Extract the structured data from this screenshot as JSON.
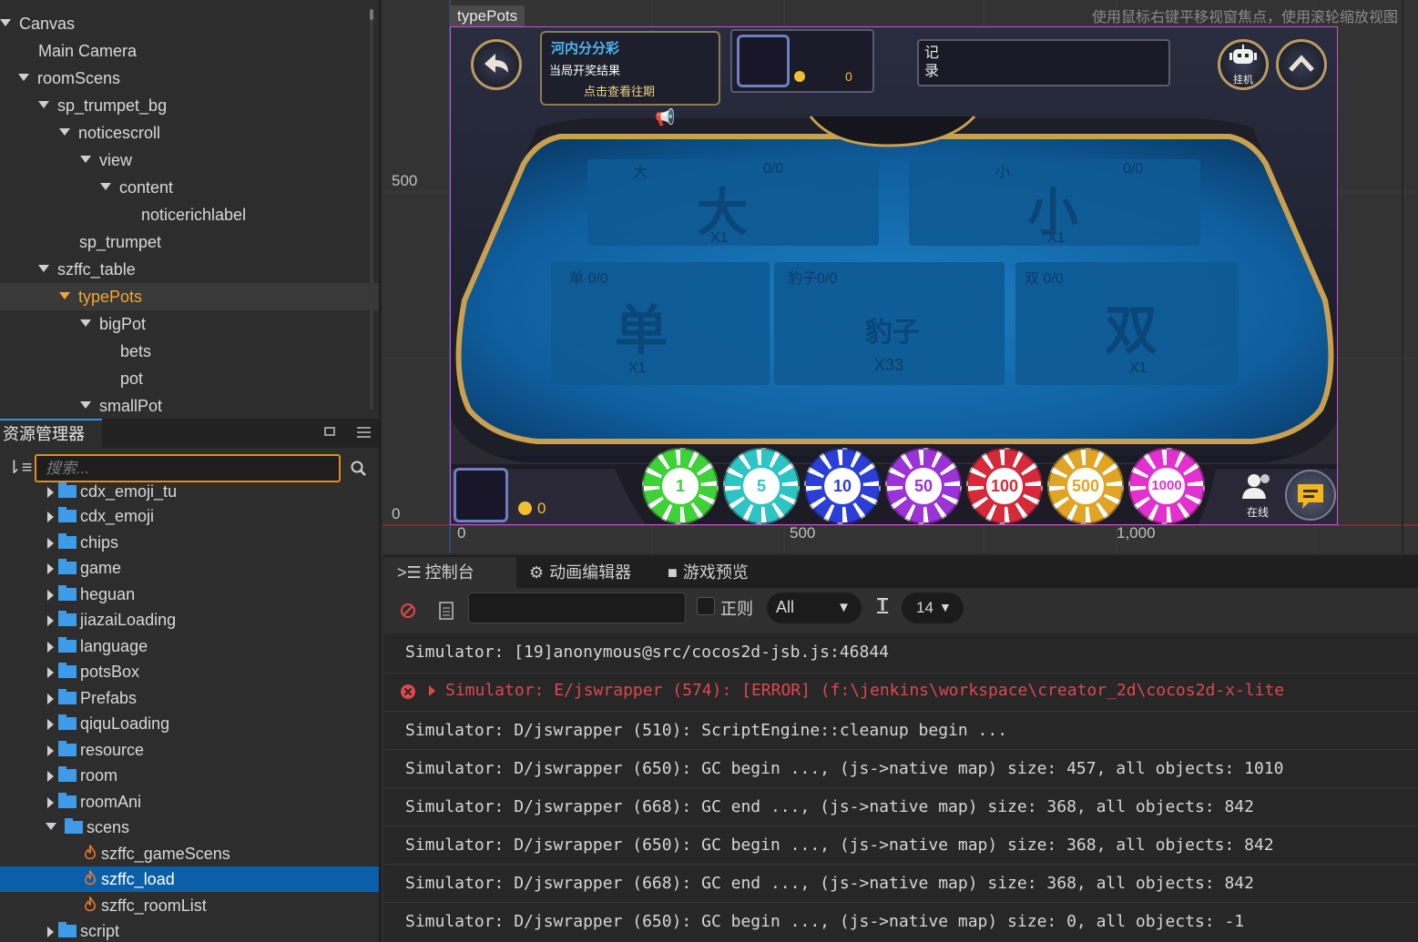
{
  "hierarchy": {
    "rows": [
      {
        "label": "Canvas",
        "expanded": true
      },
      {
        "label": "Main Camera",
        "expanded": false
      },
      {
        "label": "roomScens",
        "expanded": true
      },
      {
        "label": "sp_trumpet_bg",
        "expanded": true
      },
      {
        "label": "noticescroll",
        "expanded": true
      },
      {
        "label": "view",
        "expanded": true
      },
      {
        "label": "content",
        "expanded": true
      },
      {
        "label": "noticerichlabel",
        "expanded": false
      },
      {
        "label": "sp_trumpet",
        "expanded": false
      },
      {
        "label": "szffc_table",
        "expanded": true
      },
      {
        "label": "typePots",
        "expanded": true,
        "selected": true
      },
      {
        "label": "bigPot",
        "expanded": true
      },
      {
        "label": "bets",
        "expanded": false
      },
      {
        "label": "pot",
        "expanded": false
      },
      {
        "label": "smallPot",
        "expanded": true
      }
    ]
  },
  "assets": {
    "tab_label": "资源管理器",
    "search_placeholder": "搜索...",
    "rows": [
      {
        "label": "cdx_emoji_tu",
        "type": "folder"
      },
      {
        "label": "cdx_emoji",
        "type": "folder"
      },
      {
        "label": "chips",
        "type": "folder"
      },
      {
        "label": "game",
        "type": "folder"
      },
      {
        "label": "heguan",
        "type": "folder"
      },
      {
        "label": "jiazaiLoading",
        "type": "folder"
      },
      {
        "label": "language",
        "type": "folder"
      },
      {
        "label": "potsBox",
        "type": "folder"
      },
      {
        "label": "Prefabs",
        "type": "folder"
      },
      {
        "label": "qiquLoading",
        "type": "folder"
      },
      {
        "label": "resource",
        "type": "folder"
      },
      {
        "label": "room",
        "type": "folder"
      },
      {
        "label": "roomAni",
        "type": "folder"
      },
      {
        "label": "scens",
        "type": "folder",
        "expanded": true
      },
      {
        "label": "szffc_gameScens",
        "type": "scene"
      },
      {
        "label": "szffc_load",
        "type": "scene",
        "selected": true
      },
      {
        "label": "szffc_roomList",
        "type": "scene"
      },
      {
        "label": "script",
        "type": "folder"
      }
    ]
  },
  "scene": {
    "hint": "使用鼠标右键平移视窗焦点，使用滚轮缩放视图",
    "node_label": "typePots",
    "y_ticks": [
      "500",
      "0"
    ],
    "x_ticks": [
      "0",
      "500",
      "1,000"
    ]
  },
  "game": {
    "lottery_title": "河内分分彩",
    "lottery_sub": "当局开奖结果",
    "lottery_link": "点击查看往期",
    "top_coins": "0",
    "record_label_1": "记",
    "record_label_2": "录",
    "robot_label": "挂机",
    "pots": [
      {
        "char": "大",
        "label": "大",
        "ratio": "0/0",
        "mult": "X1"
      },
      {
        "char": "小",
        "label": "小",
        "ratio": "0/0",
        "mult": "X1"
      },
      {
        "char": "单",
        "label": "单 0/0",
        "mult": "X1"
      },
      {
        "char": "豹子",
        "label": "豹子0/0",
        "mult": "X33"
      },
      {
        "char": "双",
        "label": "双 0/0",
        "mult": "X1"
      }
    ],
    "bottom_coins": "0",
    "chips": [
      {
        "value": "1",
        "color": "#3fd13a"
      },
      {
        "value": "5",
        "color": "#2fc4c4"
      },
      {
        "value": "10",
        "color": "#2b3fd6"
      },
      {
        "value": "50",
        "color": "#9b33d6"
      },
      {
        "value": "100",
        "color": "#d42a3a"
      },
      {
        "value": "500",
        "color": "#e0a426"
      },
      {
        "value": "1000",
        "color": "#e231cf"
      }
    ],
    "online_label": "在线"
  },
  "console": {
    "tabs": [
      "控制台",
      "动画编辑器",
      "游戏预览"
    ],
    "regex_label": "正则",
    "level_select": "All",
    "font_size": "14",
    "lines": [
      {
        "text": "Simulator: [19]anonymous@src/cocos2d-jsb.js:46844",
        "error": false
      },
      {
        "text": "Simulator: E/jswrapper (574): [ERROR] (f:\\jenkins\\workspace\\creator_2d\\cocos2d-x-lite",
        "error": true
      },
      {
        "text": "Simulator: D/jswrapper (510): ScriptEngine::cleanup begin ...",
        "error": false
      },
      {
        "text": "Simulator: D/jswrapper (650): GC begin ..., (js->native map) size: 457, all objects: 1010",
        "error": false
      },
      {
        "text": "Simulator: D/jswrapper (668): GC end ..., (js->native map) size: 368, all objects: 842",
        "error": false
      },
      {
        "text": "Simulator: D/jswrapper (650): GC begin ..., (js->native map) size: 368, all objects: 842",
        "error": false
      },
      {
        "text": "Simulator: D/jswrapper (668): GC end ..., (js->native map) size: 368, all objects: 842",
        "error": false
      },
      {
        "text": "Simulator: D/jswrapper (650): GC begin ..., (js->native map) size: 0, all objects: -1",
        "error": false
      }
    ]
  }
}
